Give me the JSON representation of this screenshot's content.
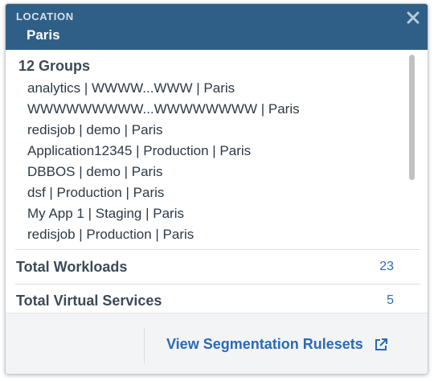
{
  "header": {
    "label": "LOCATION",
    "value": "Paris",
    "close_icon": "close-icon"
  },
  "groups": {
    "title": "12 Groups",
    "items": [
      "analytics | WWWW...WWW | Paris",
      "WWWWWWWWW...WWWWWWWW | Paris",
      "redisjob | demo | Paris",
      "Application12345 | Production | Paris",
      "DBBOS | demo | Paris",
      "dsf | Production | Paris",
      "My App 1 | Staging | Paris",
      "redisjob | Production | Paris"
    ]
  },
  "stats": {
    "workloads": {
      "label": "Total Workloads",
      "value": "23"
    },
    "virtual_services": {
      "label": "Total Virtual Services",
      "value": "5"
    }
  },
  "footer": {
    "link_label": "View Segmentation Rulesets",
    "link_icon": "external-link-icon"
  },
  "colors": {
    "header_bg": "#2f5f87",
    "link": "#2a6ab4"
  }
}
